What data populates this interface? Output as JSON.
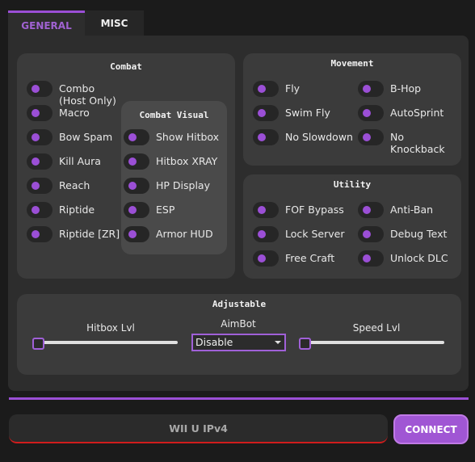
{
  "tabs": {
    "general": "GENERAL",
    "misc": "MISC"
  },
  "combat": {
    "title": "Combat",
    "items": [
      "Combo\n(Host Only)",
      "Macro",
      "Bow Spam",
      "Kill Aura",
      "Reach",
      "Riptide",
      "Riptide [ZR]"
    ]
  },
  "combat_visual": {
    "title": "Combat Visual",
    "items": [
      "Show Hitbox",
      "Hitbox XRAY",
      "HP Display",
      "ESP",
      "Armor HUD"
    ]
  },
  "movement": {
    "title": "Movement",
    "items": [
      "Fly",
      "B-Hop",
      "Swim Fly",
      "AutoSprint",
      "No Slowdown",
      "No Knockback"
    ]
  },
  "utility": {
    "title": "Utility",
    "items": [
      "FOF Bypass",
      "Anti-Ban",
      "Lock Server",
      "Debug Text",
      "Free Craft",
      "Unlock DLC"
    ]
  },
  "adjustable": {
    "title": "Adjustable",
    "hitbox_label": "Hitbox Lvl",
    "hitbox_value": 0,
    "aimbot_label": "AimBot",
    "aimbot_value": "Disable",
    "speed_label": "Speed Lvl",
    "speed_value": 0
  },
  "connection": {
    "ip_placeholder": "WII U IPv4",
    "connect_label": "CONNECT"
  },
  "colors": {
    "accent": "#9b4fd6",
    "error_underline": "#d01c1c",
    "panel": "#3b3b3b",
    "background": "#1b1b1b"
  }
}
